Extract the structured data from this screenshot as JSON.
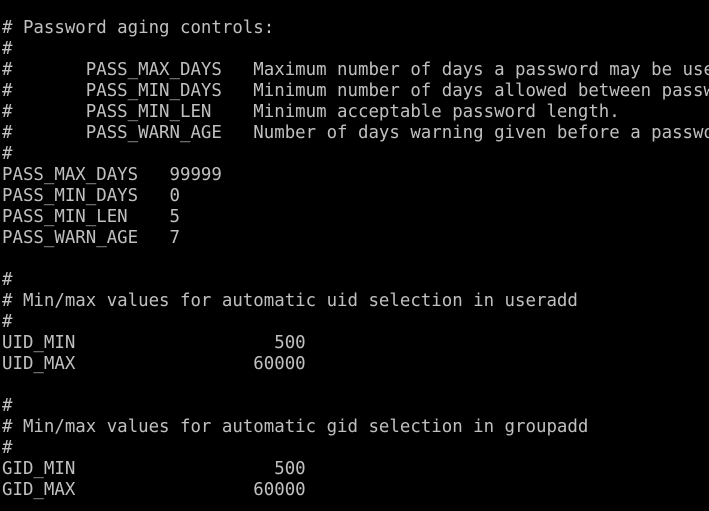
{
  "terminal": {
    "text_color": "#c0c0c0",
    "background_color": "#000000",
    "lines": [
      "# Password aging controls:",
      "#",
      "#       PASS_MAX_DAYS   Maximum number of days a password may be used.",
      "#       PASS_MIN_DAYS   Minimum number of days allowed between password changes.",
      "#       PASS_MIN_LEN    Minimum acceptable password length.",
      "#       PASS_WARN_AGE   Number of days warning given before a password expires.",
      "#",
      "PASS_MAX_DAYS   99999",
      "PASS_MIN_DAYS   0",
      "PASS_MIN_LEN    5",
      "PASS_WARN_AGE   7",
      "",
      "#",
      "# Min/max values for automatic uid selection in useradd",
      "#",
      "UID_MIN                   500",
      "UID_MAX                 60000",
      "",
      "#",
      "# Min/max values for automatic gid selection in groupadd",
      "#",
      "GID_MIN                   500",
      "GID_MAX                 60000"
    ]
  }
}
